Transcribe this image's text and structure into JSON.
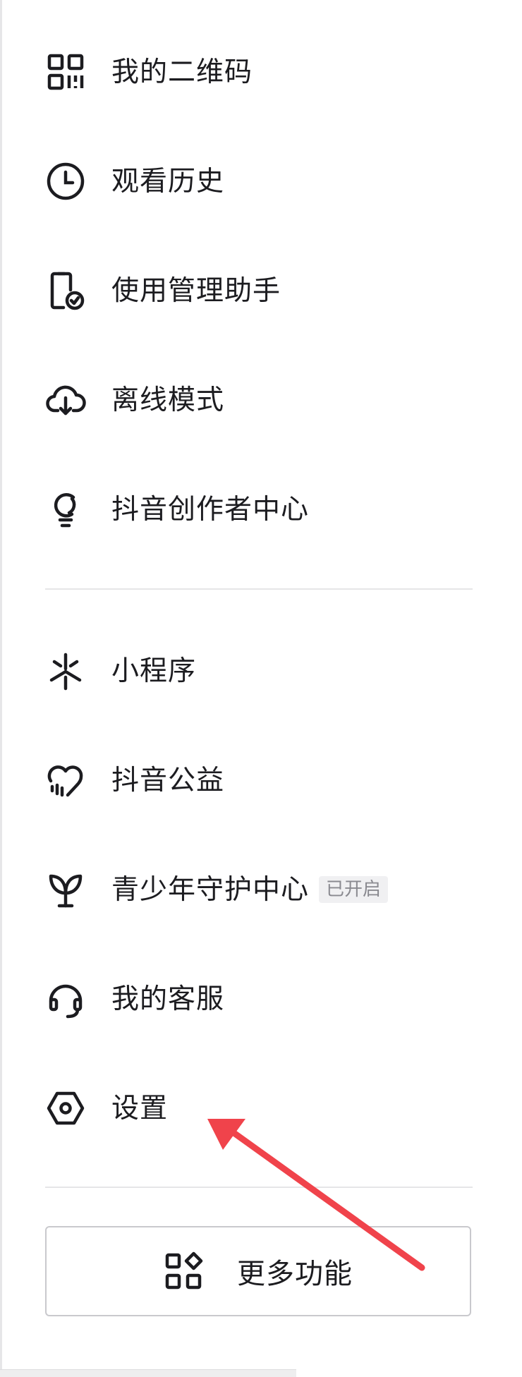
{
  "menu": {
    "items": [
      {
        "label": "我的二维码",
        "icon": "qr-code-icon"
      },
      {
        "label": "观看历史",
        "icon": "clock-icon"
      },
      {
        "label": "使用管理助手",
        "icon": "phone-check-icon"
      },
      {
        "label": "离线模式",
        "icon": "cloud-download-icon"
      },
      {
        "label": "抖音创作者中心",
        "icon": "lightbulb-icon"
      },
      {
        "label": "小程序",
        "icon": "mini-program-icon"
      },
      {
        "label": "抖音公益",
        "icon": "charity-heart-icon"
      },
      {
        "label": "青少年守护中心",
        "icon": "sprout-icon",
        "badge": "已开启"
      },
      {
        "label": "我的客服",
        "icon": "headset-icon"
      },
      {
        "label": "设置",
        "icon": "settings-hexagon-icon"
      }
    ]
  },
  "more_button": {
    "label": "更多功能",
    "icon": "grid-apps-icon"
  },
  "colors": {
    "text": "#1c1c20",
    "divider": "#e5e5e7",
    "badge_bg": "#f0f0f2",
    "arrow": "#f0434b"
  }
}
